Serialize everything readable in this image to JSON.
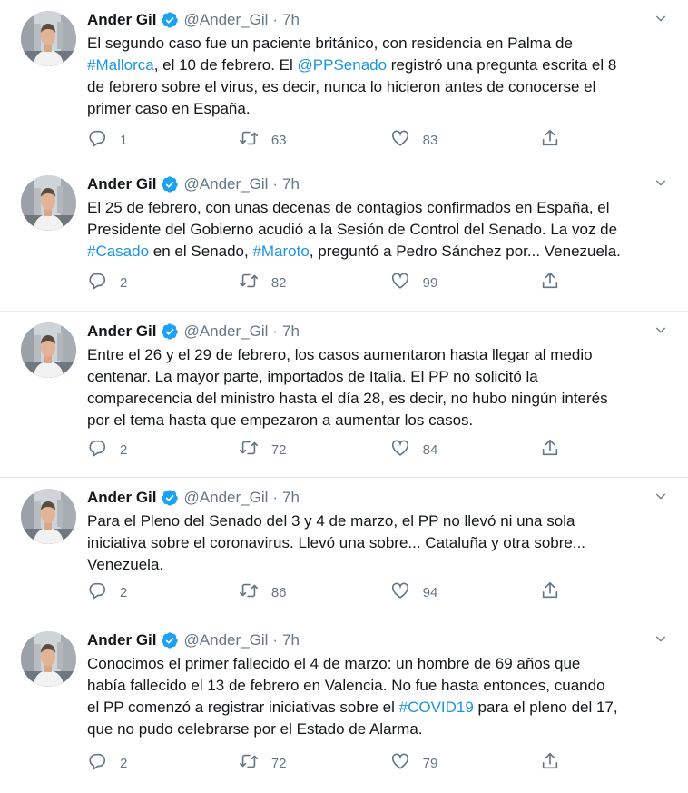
{
  "colors": {
    "accent": "#1b95e0",
    "secondary": "#657786",
    "verified": "#1da1f2"
  },
  "tweets": [
    {
      "name": "Ander Gil",
      "handle": "@Ander_Gil",
      "separator": "·",
      "time": "7h",
      "lines": [
        [
          {
            "t": "El segundo caso fue un paciente británico, con residencia en Palma de"
          }
        ],
        [
          {
            "t": "#Mallorca",
            "link": true
          },
          {
            "t": ", el 10 de febrero. El "
          },
          {
            "t": "@PPSenado",
            "link": true
          },
          {
            "t": " registró una pregunta escrita el 8"
          }
        ],
        [
          {
            "t": "de febrero sobre el virus, es decir, nunca lo hicieron antes de conocerse el"
          }
        ],
        [
          {
            "t": "primer caso en España."
          }
        ]
      ],
      "replies": "1",
      "retweets": "63",
      "likes": "83"
    },
    {
      "name": "Ander Gil",
      "handle": "@Ander_Gil",
      "separator": "·",
      "time": "7h",
      "lines": [
        [
          {
            "t": "El 25 de febrero, con unas decenas de contagios confirmados en España, el"
          }
        ],
        [
          {
            "t": "Presidente del Gobierno acudió a la Sesión de Control del Senado. La voz de"
          }
        ],
        [
          {
            "t": "#Casado",
            "link": true
          },
          {
            "t": " en el Senado, "
          },
          {
            "t": "#Maroto",
            "link": true
          },
          {
            "t": ", preguntó a Pedro Sánchez por... Venezuela."
          }
        ]
      ],
      "replies": "2",
      "retweets": "82",
      "likes": "99"
    },
    {
      "name": "Ander Gil",
      "handle": "@Ander_Gil",
      "separator": "·",
      "time": "7h",
      "lines": [
        [
          {
            "t": "Entre el 26 y el 29 de febrero, los casos aumentaron hasta llegar al medio"
          }
        ],
        [
          {
            "t": "centenar. La mayor parte, importados de Italia. El PP no solicitó la"
          }
        ],
        [
          {
            "t": "comparecencia del ministro hasta el día 28, es decir, no hubo ningún interés"
          }
        ],
        [
          {
            "t": "por el tema hasta que empezaron a aumentar los casos."
          }
        ]
      ],
      "replies": "2",
      "retweets": "72",
      "likes": "84"
    },
    {
      "name": "Ander Gil",
      "handle": "@Ander_Gil",
      "separator": "·",
      "time": "7h",
      "lines": [
        [
          {
            "t": "Para el Pleno del Senado del 3 y 4 de marzo, el PP no llevó ni una sola"
          }
        ],
        [
          {
            "t": "iniciativa sobre el coronavirus. Llevó una sobre... Cataluña y otra sobre..."
          }
        ],
        [
          {
            "t": "Venezuela."
          }
        ]
      ],
      "replies": "2",
      "retweets": "86",
      "likes": "94"
    },
    {
      "name": "Ander Gil",
      "handle": "@Ander_Gil",
      "separator": "·",
      "time": "7h",
      "lines": [
        [
          {
            "t": "Conocimos el primer fallecido el 4 de marzo: un hombre de 69 años que"
          }
        ],
        [
          {
            "t": "había fallecido el 13 de febrero en Valencia. No fue hasta entonces, cuando"
          }
        ],
        [
          {
            "t": "el PP comenzó a registrar iniciativas sobre el "
          },
          {
            "t": "#COVID19",
            "link": true
          },
          {
            "t": " para el pleno del 17,"
          }
        ],
        [
          {
            "t": "que no pudo celebrarse por el Estado de Alarma."
          }
        ]
      ],
      "replies": "2",
      "retweets": "72",
      "likes": "79"
    }
  ]
}
